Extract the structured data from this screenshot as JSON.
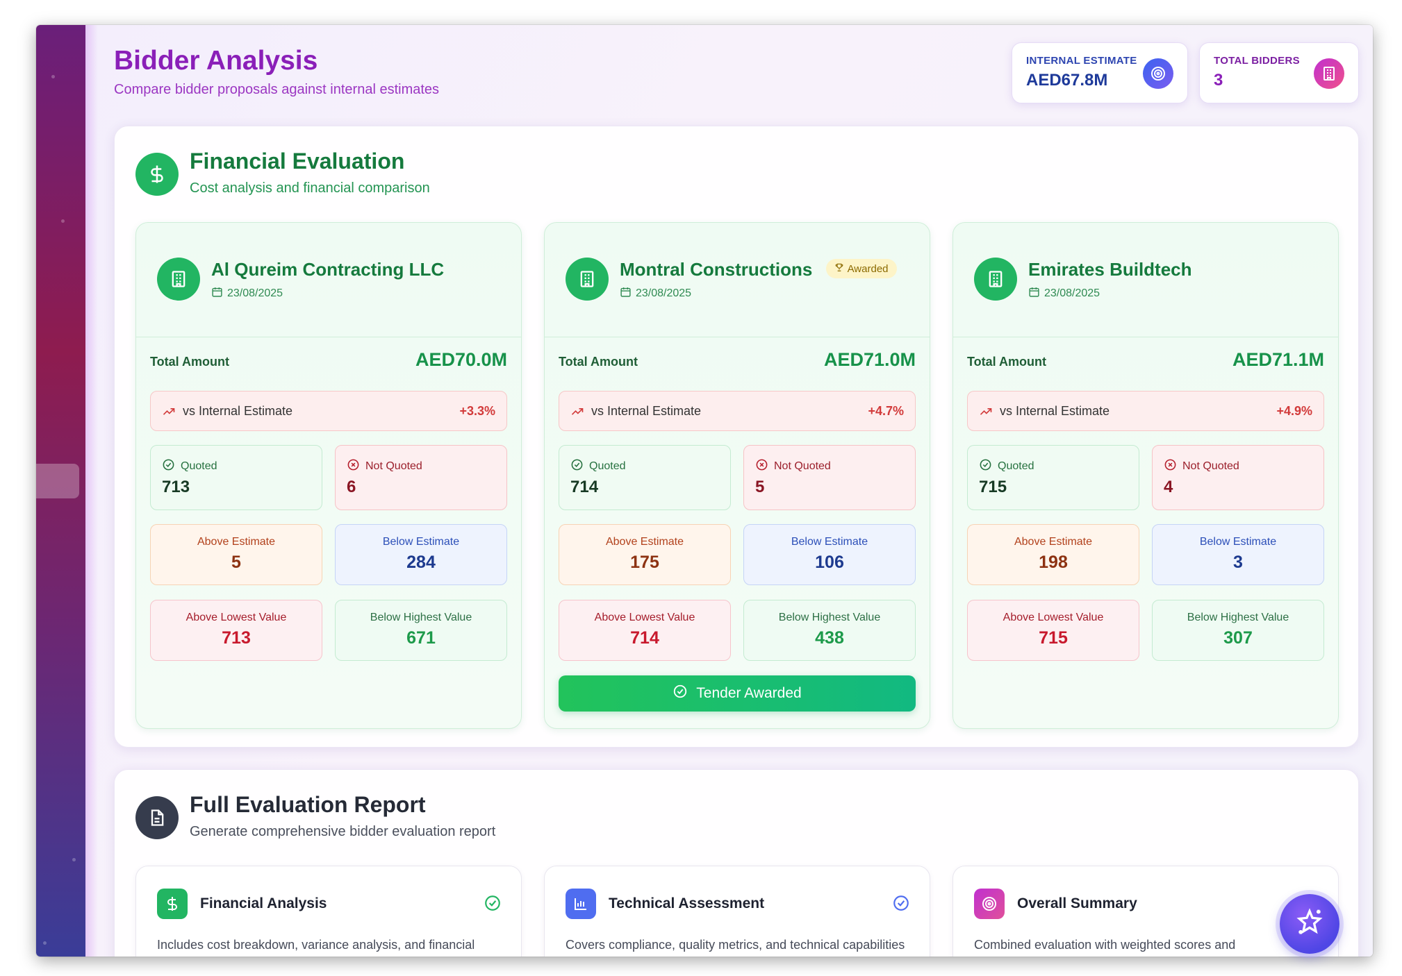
{
  "header": {
    "title": "Bidder Analysis",
    "subtitle": "Compare bidder proposals against internal estimates"
  },
  "stats": {
    "internal_estimate": {
      "label": "INTERNAL ESTIMATE",
      "value": "AED67.8M",
      "icon": "target-icon"
    },
    "total_bidders": {
      "label": "TOTAL BIDDERS",
      "value": "3",
      "icon": "building-icon"
    }
  },
  "financial": {
    "title": "Financial Evaluation",
    "subtitle": "Cost analysis and financial comparison",
    "total_amount_label": "Total Amount",
    "vs_label": "vs Internal Estimate",
    "quoted_label": "Quoted",
    "not_quoted_label": "Not Quoted",
    "above_estimate_label": "Above Estimate",
    "below_estimate_label": "Below Estimate",
    "above_lowest_label": "Above Lowest Value",
    "below_highest_label": "Below Highest Value",
    "bidders": [
      {
        "name": "Al Qureim Contracting LLC",
        "date": "23/08/2025",
        "total": "AED70.0M",
        "variance": "+3.3%",
        "quoted": "713",
        "not_quoted": "6",
        "above_estimate": "5",
        "below_estimate": "284",
        "above_lowest": "713",
        "below_highest": "671"
      },
      {
        "name": "Montral Constructions",
        "badge": "Awarded",
        "date": "23/08/2025",
        "total": "AED71.0M",
        "variance": "+4.7%",
        "quoted": "714",
        "not_quoted": "5",
        "above_estimate": "175",
        "below_estimate": "106",
        "above_lowest": "714",
        "below_highest": "438",
        "action": "Tender Awarded"
      },
      {
        "name": "Emirates Buildtech",
        "date": "23/08/2025",
        "total": "AED71.1M",
        "variance": "+4.9%",
        "quoted": "715",
        "not_quoted": "4",
        "above_estimate": "198",
        "below_estimate": "3",
        "above_lowest": "715",
        "below_highest": "307"
      }
    ]
  },
  "report": {
    "title": "Full Evaluation Report",
    "subtitle": "Generate comprehensive bidder evaluation report",
    "cards": [
      {
        "title": "Financial Analysis",
        "desc": "Includes cost breakdown, variance analysis, and financial comparisons",
        "icon": "dollar-icon",
        "color": "#22b562"
      },
      {
        "title": "Technical Assessment",
        "desc": "Covers compliance, quality metrics, and technical capabilities",
        "icon": "bar-chart-icon",
        "color": "#4f6df0"
      },
      {
        "title": "Overall Summary",
        "desc": "Combined evaluation with weighted scores and recommendations",
        "icon": "target-icon",
        "color": "#c33fd6"
      }
    ]
  },
  "colors": {
    "accent_purple": "#8a1fb8",
    "green": "#22b562",
    "red": "#d23a3a"
  }
}
